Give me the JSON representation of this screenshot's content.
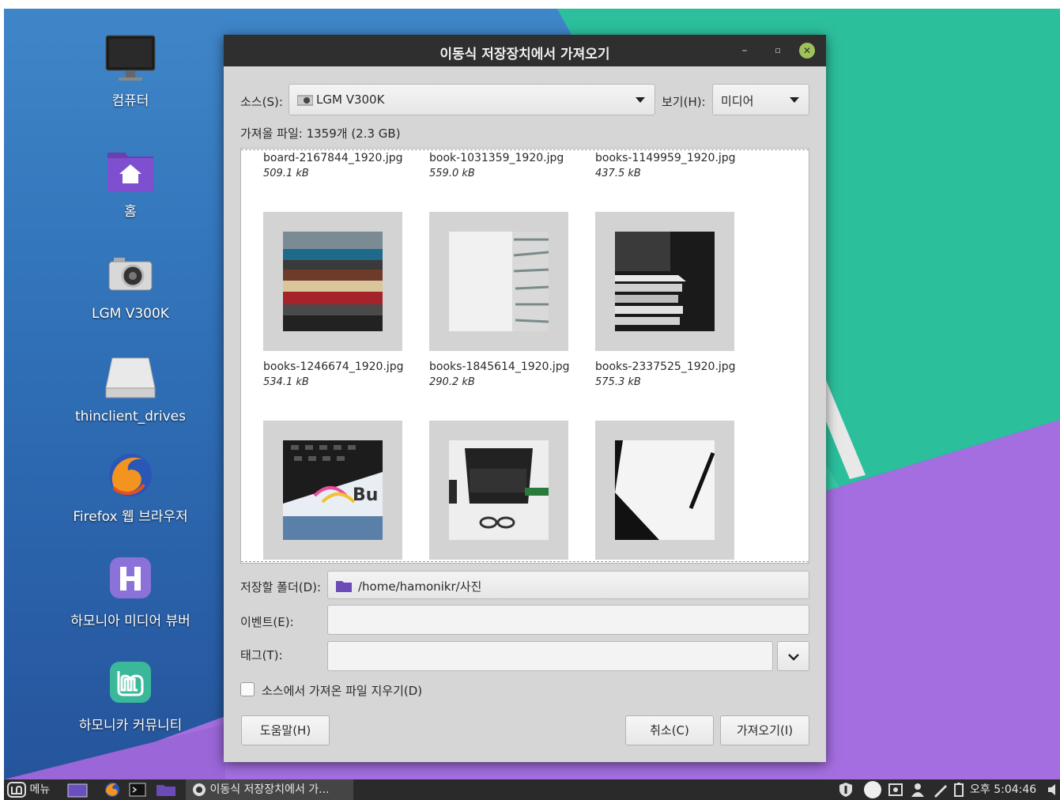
{
  "desktop": {
    "icons": [
      {
        "label": "컴퓨터",
        "icon": "computer-monitor-icon"
      },
      {
        "label": "홈",
        "icon": "home-folder-icon"
      },
      {
        "label": "LGM V300K",
        "icon": "camera-icon"
      },
      {
        "label": "thinclient_drives",
        "icon": "drive-icon"
      },
      {
        "label": "Firefox 웹 브라우저",
        "icon": "firefox-icon"
      },
      {
        "label": "하모니아 미디어 뷰버",
        "icon": "hamonia-viewer-icon"
      },
      {
        "label": "하모니카 커뮤니티",
        "icon": "hamonikr-community-icon"
      }
    ]
  },
  "dialog": {
    "title": "이동식 저장장치에서 가져오기",
    "window_buttons": {
      "minimize": "–",
      "maximize": "▫",
      "close": "✕"
    },
    "source": {
      "label": "소스(S):",
      "value": "LGM V300K",
      "icon": "camera-small-icon"
    },
    "view": {
      "label": "보기(H):",
      "value": "미디어"
    },
    "files_to_import": "가져올 파일: 1359개 (2.3 GB)",
    "files": [
      {
        "name": "board-2167844_1920.jpg",
        "size": "509.1 kB"
      },
      {
        "name": "book-1031359_1920.jpg",
        "size": "559.0 kB"
      },
      {
        "name": "books-1149959_1920.jpg",
        "size": "437.5 kB"
      },
      {
        "name": "books-1246674_1920.jpg",
        "size": "534.1 kB"
      },
      {
        "name": "books-1845614_1920.jpg",
        "size": "290.2 kB"
      },
      {
        "name": "books-2337525_1920.jpg",
        "size": "575.3 kB"
      }
    ],
    "destination": {
      "label": "저장할 폴더(D):",
      "value": "/home/hamonikr/사진",
      "icon": "folder-icon"
    },
    "event": {
      "label": "이벤트(E):",
      "value": ""
    },
    "tags": {
      "label": "태그(T):",
      "value": ""
    },
    "delete_checkbox": {
      "label": "소스에서 가져온 파일 지우기(D)",
      "checked": false
    },
    "buttons": {
      "help": "도움말(H)",
      "cancel": "취소(C)",
      "import": "가져오기(I)"
    }
  },
  "panel": {
    "menu_label": "메뉴",
    "task_label": "이동식 저장장치에서 가...",
    "clock": "오후 5:04:46"
  },
  "colors": {
    "titlebar": "#2f2f2f",
    "dialog_bg": "#d6d6d6",
    "panel": "#2a2a2a",
    "desktop_blue": "#3f86c8",
    "desktop_teal": "#2cbf9c",
    "desktop_purple": "#a46ee0"
  }
}
